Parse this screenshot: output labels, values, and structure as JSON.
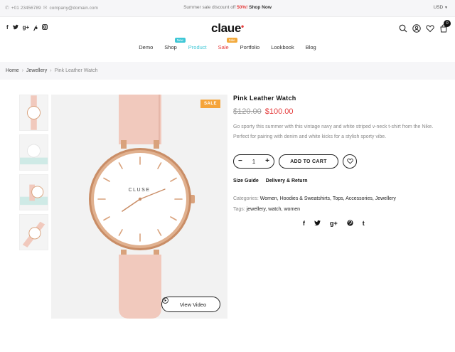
{
  "topbar": {
    "phone": "+01 23456789",
    "email": "company@domain.com",
    "promo_prefix": "Summer sale discount off",
    "promo_percent": "50%!",
    "promo_link": "Shop Now",
    "currency": "USD"
  },
  "header": {
    "logo": "claue",
    "cart_count": "0",
    "social_icons": [
      "facebook-icon",
      "twitter-icon",
      "google-plus-icon",
      "pinterest-icon",
      "instagram-icon"
    ]
  },
  "nav": [
    {
      "label": "Demo",
      "badge": ""
    },
    {
      "label": "Shop",
      "badge": "New"
    },
    {
      "label": "Product",
      "badge": ""
    },
    {
      "label": "Sale",
      "badge": "Sale"
    },
    {
      "label": "Portfolio",
      "badge": ""
    },
    {
      "label": "Lookbook",
      "badge": ""
    },
    {
      "label": "Blog",
      "badge": ""
    }
  ],
  "breadcrumb": {
    "home": "Home",
    "category": "Jewellery",
    "current": "Pink Leather Watch"
  },
  "product": {
    "sale_tag": "SALE",
    "view_video": "View Video",
    "title": "Pink Leather Watch",
    "price_old": "$120.00",
    "price_new": "$100.00",
    "description": "Go sporty this summer with this vintage navy and white striped v-neck t-shirt from the Nike. Perfect for pairing with denim and white kicks for a stylish sporty vibe.",
    "quantity": "1",
    "add_to_cart": "ADD TO CART",
    "size_guide": "Size Guide",
    "delivery_return": "Delivery & Return",
    "categories_label": "Categories:",
    "categories": "Women, Hoodies & Sweatshirts, Tops, Accessories, Jewellery",
    "tags_label": "Tags:",
    "tags": "jewellery, watch, women",
    "watch_brand": "CLUSE",
    "share_icons": [
      "facebook-icon",
      "twitter-icon",
      "google-plus-icon",
      "pinterest-icon",
      "tumblr-icon"
    ]
  },
  "colors": {
    "accent_red": "#e43a3a",
    "accent_teal": "#3ec7d6",
    "sale_orange": "#f5a43a",
    "strap_pink": "#f1c9bd",
    "rose_gold": "#d9a27c"
  }
}
